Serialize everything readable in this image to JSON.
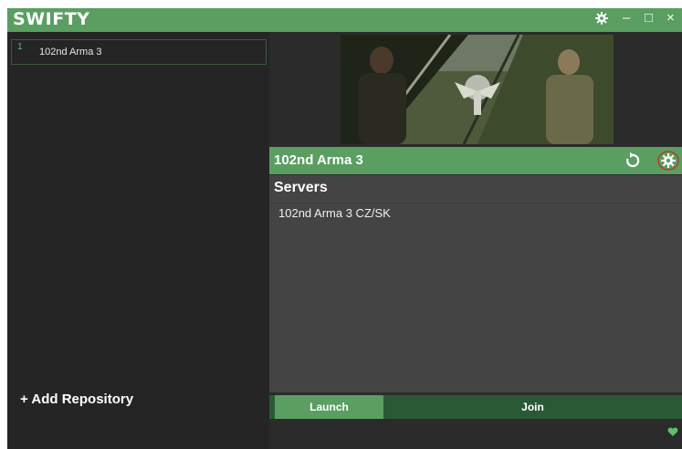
{
  "app": {
    "title": "SWIFTY"
  },
  "window_controls": {
    "settings_icon": "gear-icon",
    "minimize": "–",
    "maximize": "□",
    "close": "×"
  },
  "sidebar": {
    "repositories": [
      {
        "index": "1",
        "name": "102nd Arma 3"
      }
    ],
    "add_repository_label": "+ Add Repository"
  },
  "repository": {
    "name": "102nd Arma 3",
    "banner_image": "soldiers-emblem-banner",
    "icons": {
      "refresh": "refresh-icon",
      "settings": "gear-icon"
    }
  },
  "servers": {
    "header": "Servers",
    "items": [
      "102nd Arma 3 CZ/SK"
    ]
  },
  "actions": {
    "launch_label": "Launch",
    "join_label": "Join"
  },
  "status_icon": "heart-icon",
  "colors": {
    "accent": "#5a9e62",
    "background": "#252525",
    "panel": "#444444",
    "annotation": "#c0392b"
  }
}
